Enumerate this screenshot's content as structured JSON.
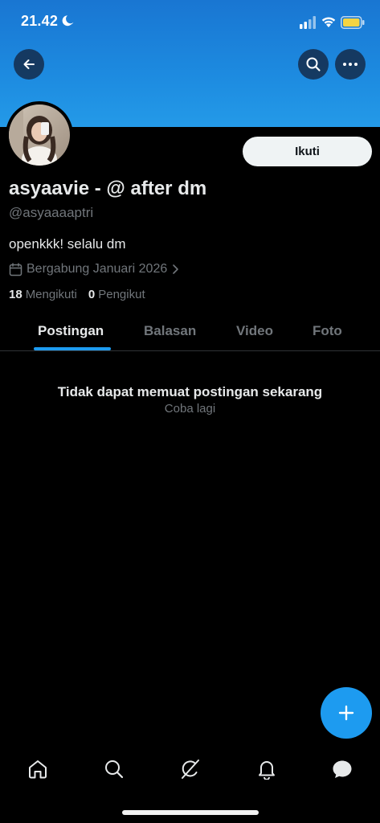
{
  "status_bar": {
    "time": "21.42",
    "moon_icon": "moon-icon",
    "signal_icon": "cellular-signal-icon",
    "wifi_icon": "wifi-icon",
    "battery_icon": "battery-icon",
    "battery_color": "#f5d442"
  },
  "header": {
    "back_icon": "arrow-left-icon",
    "search_icon": "search-icon",
    "more_icon": "more-horizontal-icon",
    "banner_color": "#1d8be0"
  },
  "profile": {
    "display_name": "asyaavie - @ after dm",
    "handle": "@asyaaaaptri",
    "bio": "openkkk! selalu dm",
    "joined": "Bergabung Januari 2026",
    "follow_label": "Ikuti",
    "following_count": "18",
    "following_label": "Mengikuti",
    "followers_count": "0",
    "followers_label": "Pengikut"
  },
  "tabs": [
    {
      "label": "Postingan",
      "active": true
    },
    {
      "label": "Balasan",
      "active": false
    },
    {
      "label": "Video",
      "active": false
    },
    {
      "label": "Foto",
      "active": false
    }
  ],
  "feed": {
    "empty_title": "Tidak dapat memuat postingan sekarang",
    "retry_label": "Coba lagi"
  },
  "fab": {
    "icon": "plus-icon",
    "color": "#1d9bf0"
  },
  "bottom_nav": [
    {
      "icon": "home-icon"
    },
    {
      "icon": "search-icon"
    },
    {
      "icon": "grok-icon"
    },
    {
      "icon": "bell-icon"
    },
    {
      "icon": "messages-icon"
    }
  ],
  "colors": {
    "accent": "#1d9bf0",
    "text_primary": "#e7e9ea",
    "text_secondary": "#71767b",
    "background": "#000000"
  }
}
